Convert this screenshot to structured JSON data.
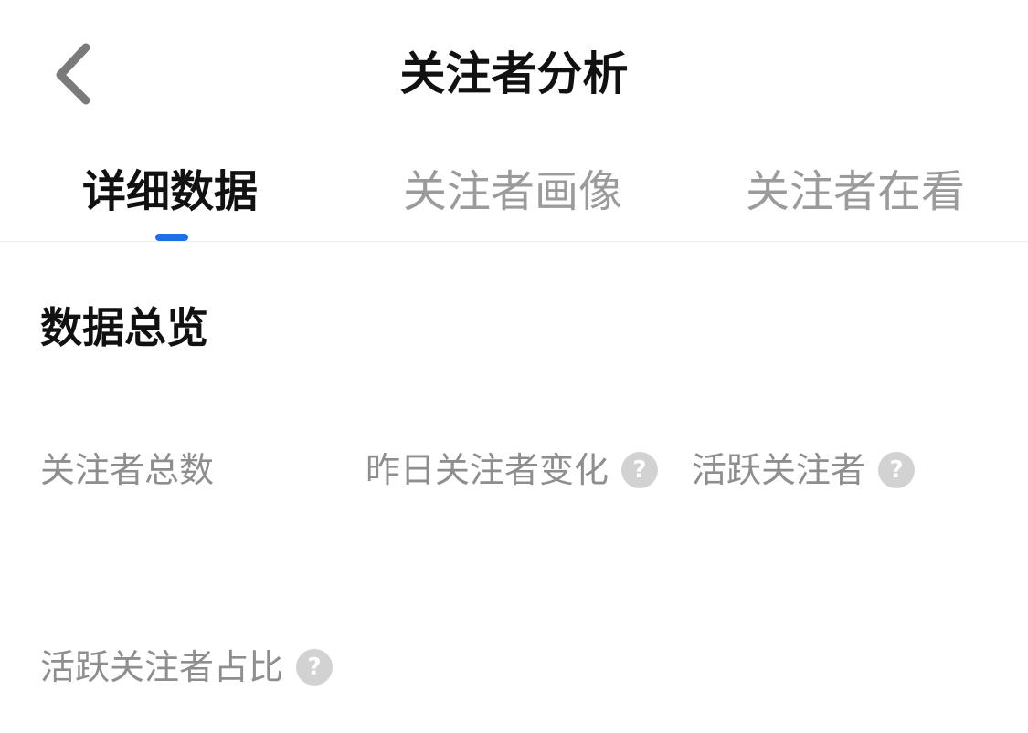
{
  "header": {
    "back_icon": "chevron-left-icon",
    "title": "关注者分析"
  },
  "tabs": [
    {
      "label": "详细数据",
      "active": true
    },
    {
      "label": "关注者画像",
      "active": false
    },
    {
      "label": "关注者在看",
      "active": false
    }
  ],
  "colors": {
    "accent": "#1f6fe5",
    "text_primary": "#111111",
    "text_secondary": "#8e8e8e",
    "help_icon_bg": "#d2d2d2"
  },
  "overview": {
    "title": "数据总览",
    "metrics": [
      {
        "label": "关注者总数",
        "has_help": false
      },
      {
        "label": "昨日关注者变化",
        "has_help": true
      },
      {
        "label": "活跃关注者",
        "has_help": true
      },
      {
        "label": "活跃关注者占比",
        "has_help": true
      }
    ],
    "help_glyph": "?"
  }
}
